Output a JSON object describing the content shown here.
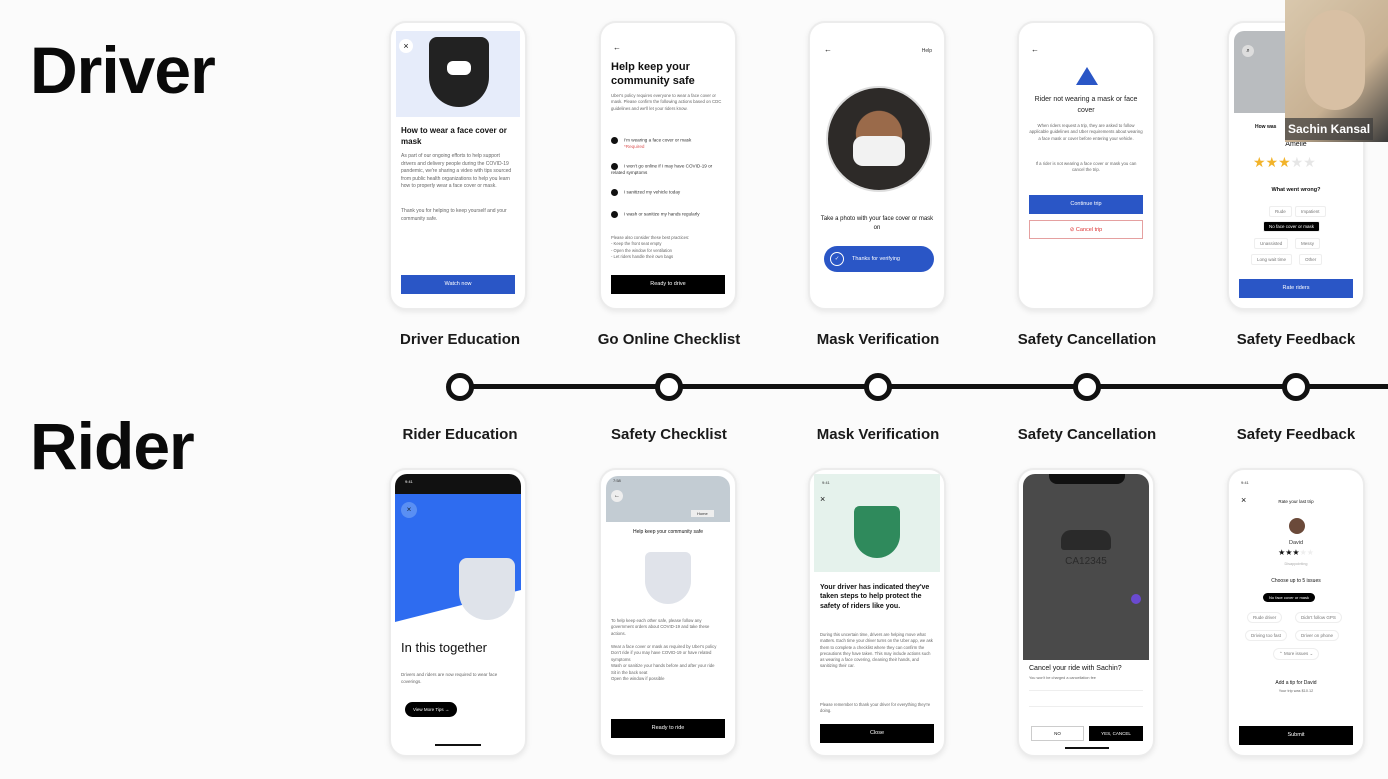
{
  "sections": {
    "driver": "Driver",
    "rider": "Rider"
  },
  "driver_steps": [
    "Driver Education",
    "Go Online Checklist",
    "Mask Verification",
    "Safety Cancellation",
    "Safety Feedback"
  ],
  "rider_steps": [
    "Rider Education",
    "Safety Checklist",
    "Mask Verification",
    "Safety Cancellation",
    "Safety Feedback"
  ],
  "colors": {
    "accent_blue": "#2a56c6",
    "timeline": "#111111",
    "star": "#f2b32a",
    "cancel_red": "#d33"
  },
  "video": {
    "participant_name": "Sachin Kansal"
  },
  "driver_phones": {
    "education": {
      "title": "How to wear a face cover or mask",
      "body": "As part of our ongoing efforts to help support drivers and delivery people during the COVID-19 pandemic, we're sharing a video with tips sourced from public health organizations to help you learn how to properly wear a face cover or mask.",
      "body2": "Thank you for helping to keep yourself and your community safe.",
      "button": "Watch now"
    },
    "checklist": {
      "title": "Help keep your community safe",
      "intro": "Uber's policy requires everyone to wear a face cover or mask. Please confirm the following actions based on CDC guidelines and we'll let your riders know.",
      "items": [
        "I'm wearing a face cover or mask",
        "I won't go online if I may have COVID-19 or related symptoms",
        "I sanitized my vehicle today",
        "I wash or sanitize my hands regularly"
      ],
      "required": "*Required",
      "practices": "Please also consider these best practices:\n- Keep the front seat empty\n- Open the window for ventilation\n- Let riders handle their own bags",
      "button": "Ready to drive"
    },
    "mask": {
      "help": "Help",
      "caption": "Take a photo with your face cover or mask on",
      "button": "Thanks for verifying"
    },
    "cancellation": {
      "title": "Rider not wearing a mask or face cover",
      "body": "When riders request a trip, they are asked to follow applicable guidelines and Uber requirements about wearing a face mask or cover before entering your vehicle.",
      "body2": "If a rider is not wearing a face cover or mask you can cancel the trip.",
      "continue": "Continue trip",
      "cancel": "Cancel trip"
    },
    "feedback": {
      "question": "How was",
      "name": "Amélie",
      "rating": 3,
      "max_rating": 5,
      "what_wrong": "What went wrong?",
      "chips": [
        "Rude",
        "Impatient",
        "No face cover or mask",
        "Unassisted",
        "Messy",
        "Long wait time",
        "Other"
      ],
      "selected_chip": "No face cover or mask",
      "button": "Rate riders"
    }
  },
  "rider_phones": {
    "education": {
      "time": "9:41",
      "title": "In this together",
      "body": "Drivers and riders are now required to wear face coverings.",
      "button": "View More Tips →"
    },
    "checklist": {
      "time": "7:58",
      "map_chip": "Home",
      "title": "Help keep your community safe",
      "intro": "To help keep each other safe, please follow any government orders about COVID-19 and take these actions.",
      "bullets": [
        "Wear a face cover or mask as required by Uber's policy",
        "Don't ride if you may have COVID-19 or have related symptoms",
        "Wash or sanitize your hands before and after your ride",
        "Sit in the back seat",
        "Open the window if possible"
      ],
      "button": "Ready to ride"
    },
    "mask": {
      "time": "9:41",
      "title": "Your driver has indicated they've taken steps to help protect the safety of riders like you.",
      "body": "During this uncertain time, drivers are helping move what matters. Each time your driver turns on the Uber app, we ask them to complete a checklist where they can confirm the precautions they have taken. This may include actions such as wearing a face covering, cleaning their hands, and sanitizing their car.",
      "body2": "Please remember to thank your driver for everything they're doing.",
      "button": "Close"
    },
    "cancellation": {
      "plate": "CA12345",
      "title": "Cancel your ride with Sachin?",
      "subtitle": "You won't be charged a cancellation fee",
      "no": "NO",
      "yes": "YES, CANCEL"
    },
    "feedback": {
      "time": "9:41",
      "title": "Rate your last trip",
      "name": "David",
      "rating": 3,
      "max_rating": 5,
      "rating_label": "Disappointing",
      "choose": "Choose up to 5 issues",
      "chips": [
        "No face cover or mask",
        "Rude driver",
        "Didn't follow GPS",
        "Driving too fast",
        "Driver on phone"
      ],
      "more": "More issues",
      "tip_title": "Add a tip for David",
      "tip_sub": "Your trip was $10.12",
      "button": "Submit"
    }
  }
}
